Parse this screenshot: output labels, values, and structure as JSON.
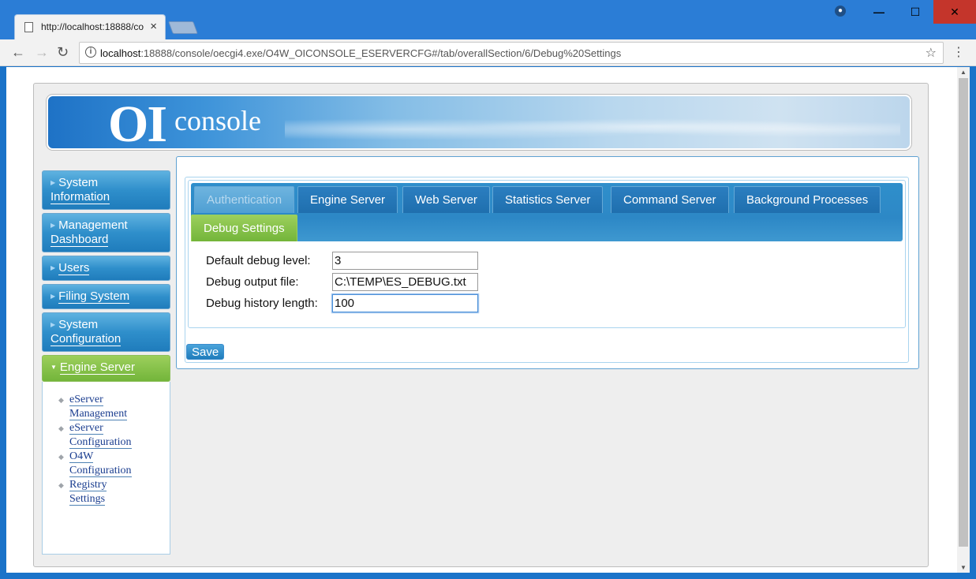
{
  "browser": {
    "tab_title": "http://localhost:18888/co",
    "tab_close": "×",
    "url_host": "localhost",
    "url_rest": ":18888/console/oecgi4.exe/O4W_OICONSOLE_ESERVERCFG#/tab/overallSection/6/Debug%20Settings",
    "back_glyph": "←",
    "forward_glyph": "→",
    "reload_glyph": "↻",
    "star_glyph": "☆",
    "menu_glyph": "⋮",
    "info_glyph": "i",
    "user_glyph": "●",
    "min_glyph": "—",
    "max_glyph": "☐",
    "close_glyph": "✕"
  },
  "banner": {
    "logo_oi": "OI",
    "logo_console": "console"
  },
  "sidebar": {
    "items": [
      {
        "label_line1": "System",
        "label_line2": "Information"
      },
      {
        "label_line1": "Management",
        "label_line2": "Dashboard"
      },
      {
        "label": "Users"
      },
      {
        "label": "Filing System"
      },
      {
        "label_line1": "System",
        "label_line2": "Configuration"
      },
      {
        "label": "Engine Server"
      }
    ],
    "tri_right": "▶",
    "tri_down": "▼",
    "submenu": [
      {
        "line1": "eServer",
        "line2": "Management"
      },
      {
        "line1": "eServer",
        "line2": "Configuration"
      },
      {
        "line1": "O4W",
        "line2": "Configuration"
      },
      {
        "line1": "Registry",
        "line2": "Settings"
      }
    ],
    "bullet": "◆"
  },
  "tabs": [
    {
      "label": "Authentication"
    },
    {
      "label": "Engine Server"
    },
    {
      "label": "Web Server"
    },
    {
      "label": "Statistics Server"
    },
    {
      "label": "Command Server"
    },
    {
      "label": "Background Processes"
    },
    {
      "label": "Debug Settings"
    }
  ],
  "form": {
    "debug_level_label": "Default debug level:",
    "debug_level_value": "3",
    "output_file_label": "Debug output file:",
    "output_file_value": "C:\\TEMP\\ES_DEBUG.txt",
    "history_label": "Debug history length:",
    "history_value": "100",
    "save_label": "Save"
  },
  "colors": {
    "accent_blue": "#2f8fcb",
    "active_green": "#73b53a"
  }
}
